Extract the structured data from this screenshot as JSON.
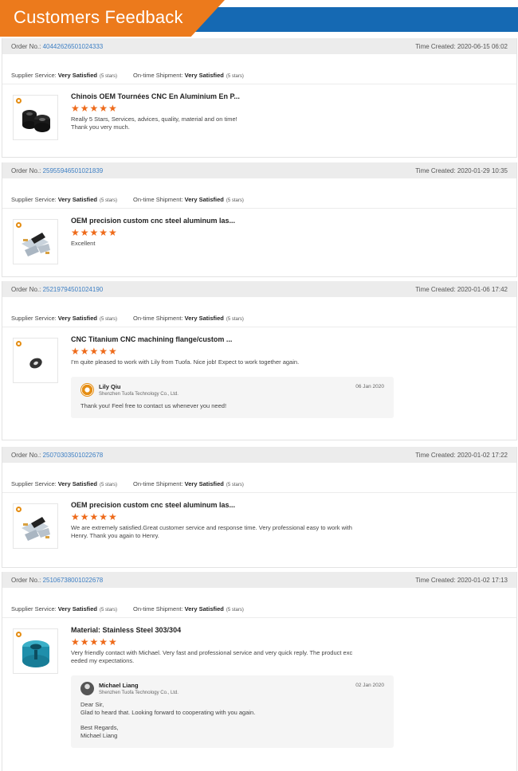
{
  "header": {
    "title": "Customers Feedback"
  },
  "labels": {
    "order_no": "Order No.:",
    "time_created": "Time Created:",
    "supplier_service": "Supplier Service:",
    "ontime_shipment": "On-time Shipment:"
  },
  "orders": [
    {
      "order_no": "40442626501024333",
      "time_created": "2020-06-15 06:02",
      "supplier_rating": "Very Satisfied",
      "supplier_stars": "(5 stars)",
      "shipment_rating": "Very Satisfied",
      "shipment_stars": "(5 stars)",
      "product_title": "Chinois OEM Tournées CNC En Aluminium En P...",
      "stars": "★★★★★",
      "comment_lines": [
        "Really 5 Stars, Services, advices, quality, material and on time!",
        "Thank you very much."
      ],
      "thumb_icon": "black-bushing-part-icon"
    },
    {
      "order_no": "25955946501021839",
      "time_created": "2020-01-29 10:35",
      "supplier_rating": "Very Satisfied",
      "supplier_stars": "(5 stars)",
      "shipment_rating": "Very Satisfied",
      "shipment_stars": "(5 stars)",
      "product_title": "OEM precision custom cnc steel aluminum las...",
      "stars": "★★★★★",
      "comment_lines": [
        "Excellent"
      ],
      "thumb_icon": "sheet-metal-parts-icon"
    },
    {
      "order_no": "25219794501024190",
      "time_created": "2020-01-06 17:42",
      "supplier_rating": "Very Satisfied",
      "supplier_stars": "(5 stars)",
      "shipment_rating": "Very Satisfied",
      "shipment_stars": "(5 stars)",
      "product_title": "CNC Titanium CNC machining flange/custom ...",
      "stars": "★★★★★",
      "comment_lines": [
        "I'm quite pleased to work with Lily from Tuofa. Nice job! Expect to work together  again."
      ],
      "thumb_icon": "flange-ring-icon",
      "reply": {
        "name": "Lily Qiu",
        "company": "Shenzhen Tuofa Technology Co., Ltd.",
        "date": "06 Jan 2020",
        "lines": [
          "Thank you! Feel free to contact us whenever you need!"
        ]
      }
    },
    {
      "order_no": "25070303501022678",
      "time_created": "2020-01-02 17:22",
      "supplier_rating": "Very Satisfied",
      "supplier_stars": "(5 stars)",
      "shipment_rating": "Very Satisfied",
      "shipment_stars": "(5 stars)",
      "product_title": "OEM precision custom cnc steel aluminum las...",
      "stars": "★★★★★",
      "comment_lines": [
        "We are extremely satisfied.Great customer service and response time. Very professional easy to work with",
        "Henry. Thank you again to Henry."
      ],
      "thumb_icon": "sheet-metal-parts-icon"
    },
    {
      "order_no": "25106738001022678",
      "time_created": "2020-01-02 17:13",
      "supplier_rating": "Very Satisfied",
      "supplier_stars": "(5 stars)",
      "shipment_rating": "Very Satisfied",
      "shipment_stars": "(5 stars)",
      "product_title": "Material: Stainless Steel 303/304",
      "stars": "★★★★★",
      "comment_lines": [
        "Very friendly contact with Michael. Very fast and professional service and very quick reply. The product exc",
        "eeded my expectations."
      ],
      "thumb_icon": "teal-coupling-part-icon",
      "reply": {
        "name": "Michael Liang",
        "company": "Shenzhen Tuofa Technology Co., Ltd.",
        "date": "02 Jan 2020",
        "lines": [
          "Dear Sir,",
          "Glad to heard that. Looking forward to cooperating with you again.",
          "",
          "Best Regards,",
          "Michael Liang"
        ]
      }
    }
  ]
}
